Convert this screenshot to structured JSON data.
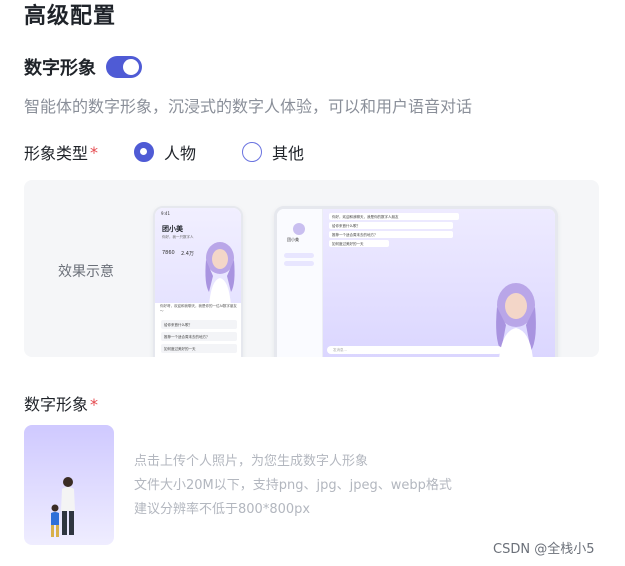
{
  "section": {
    "title": "高级配置"
  },
  "digital_human": {
    "label": "数字形象",
    "enabled": true,
    "description": "智能体的数字形象，沉浸式的数字人体验，可以和用户语音对话"
  },
  "type": {
    "label": "形象类型",
    "required_mark": "*",
    "options": [
      {
        "label": "人物",
        "checked": true
      },
      {
        "label": "其他",
        "checked": false
      }
    ]
  },
  "preview": {
    "label": "效果示意",
    "phone": {
      "status_time": "9:41",
      "name": "团小美",
      "subtitle": "你好，我一只数字人",
      "stat_a": "7860",
      "stat_b": "2.4万",
      "intro": "你好呀，欢迎和我聊天，我是你的一位AI数字朋友～",
      "questions": [
        "给你来首什么歌？",
        "推荐一个适合周末去的地方？",
        "如何度过美好的一天"
      ]
    },
    "tablet": {
      "name": "团小美",
      "bubbles": [
        "你好，欢迎和我聊天，我是你的数字人朋友",
        "给你来首什么歌？",
        "推荐一个适合周末去的地方？",
        "如何度过美好的一天"
      ],
      "input_placeholder": "发消息..."
    }
  },
  "avatar_upload": {
    "label": "数字形象",
    "required_mark": "*",
    "tips": [
      "点击上传个人照片，为您生成数字人形象",
      "文件大小20M以下，支持png、jpg、jpeg、webp格式",
      "建议分辨率不低于800*800px"
    ]
  },
  "watermark": "CSDN @全栈小5",
  "colors": {
    "accent": "#4f5bd5",
    "required": "#e5484d",
    "muted": "#8a8f99"
  }
}
